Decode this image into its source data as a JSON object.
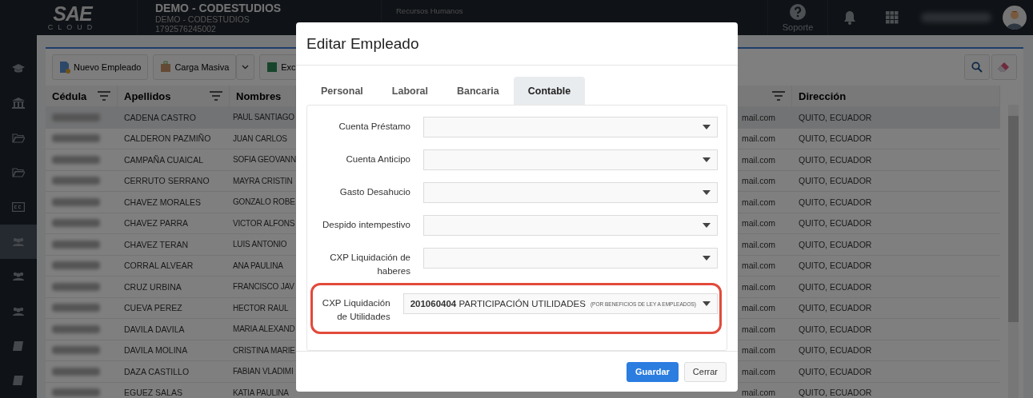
{
  "header": {
    "logo": {
      "word": "SAE",
      "sub": "CLOUD"
    },
    "company": {
      "name": "DEMO - CODESTUDIOS",
      "subtitle": "DEMO - CODESTUDIOS",
      "ruc": "1792576245002"
    },
    "module": {
      "section": "Recursos Humanos"
    },
    "support": "Soporte"
  },
  "sidebar": {
    "items": [
      {
        "selected": false
      },
      {
        "selected": false
      },
      {
        "selected": false
      },
      {
        "selected": false
      },
      {
        "selected": false
      },
      {
        "selected": true
      },
      {
        "selected": false
      },
      {
        "selected": false
      },
      {
        "selected": false
      },
      {
        "selected": false
      }
    ]
  },
  "toolbar": {
    "buttons": [
      "Nuevo Empleado",
      "Carga Masiva",
      "Exc"
    ]
  },
  "table": {
    "columns": [
      "Cédula",
      "Apellidos",
      "Nombres",
      "Dirección"
    ],
    "rows": [
      {
        "apellidos": "CADENA CASTRO",
        "nombres": "PAUL SANTIAGO",
        "email": "mail.com",
        "direccion": "QUITO, ECUADOR"
      },
      {
        "apellidos": "CALDERON PAZMIÑO",
        "nombres": "JUAN CARLOS",
        "email": "mail.com",
        "direccion": "QUITO, ECUADOR"
      },
      {
        "apellidos": "CAMPAÑA CUAICAL",
        "nombres": "SOFIA GEOVANN",
        "email": "mail.com",
        "direccion": "QUITO, ECUADOR"
      },
      {
        "apellidos": "CERRUTO SERRANO",
        "nombres": "MAYRA CRISTIN",
        "email": "mail.com",
        "direccion": "QUITO, ECUADOR"
      },
      {
        "apellidos": "CHAVEZ MORALES",
        "nombres": "GONZALO ROBE",
        "email": "mail.com",
        "direccion": "QUITO, ECUADOR"
      },
      {
        "apellidos": "CHAVEZ PARRA",
        "nombres": "VICTOR ALFONS",
        "email": "mail.com",
        "direccion": "QUITO, ECUADOR"
      },
      {
        "apellidos": "CHAVEZ TERAN",
        "nombres": "LUIS ANTONIO",
        "email": "mail.com",
        "direccion": "QUITO, ECUADOR"
      },
      {
        "apellidos": "CORRAL ALVEAR",
        "nombres": "ANA PAULINA",
        "email": "mail.com",
        "direccion": "QUITO, ECUADOR"
      },
      {
        "apellidos": "CRUZ URBINA",
        "nombres": "FRANCISCO JAV",
        "email": "mail.com",
        "direccion": "QUITO, ECUADOR"
      },
      {
        "apellidos": "CUEVA PEREZ",
        "nombres": "HECTOR RAUL",
        "email": "mail.com",
        "direccion": "QUITO, ECUADOR"
      },
      {
        "apellidos": "DAVILA DAVILA",
        "nombres": "MARIA ALEXAND",
        "email": "mail.com",
        "direccion": "QUITO, ECUADOR"
      },
      {
        "apellidos": "DAVILA MOLINA",
        "nombres": "CRISTINA MARIE",
        "email": "mail.com",
        "direccion": "QUITO, ECUADOR"
      },
      {
        "apellidos": "DAZA CASTILLO",
        "nombres": "FABIAN VLADIMI",
        "email": "mail.com",
        "direccion": "QUITO, ECUADOR"
      },
      {
        "apellidos": "EGUEZ SALAS",
        "nombres": "KATIA PAULINA",
        "email": "mail.com",
        "direccion": "QUITO, ECUADOR"
      }
    ]
  },
  "dialog": {
    "title": "Editar Empleado",
    "tabs": [
      {
        "label": "Personal",
        "selected": false
      },
      {
        "label": "Laboral",
        "selected": false
      },
      {
        "label": "Bancaria",
        "selected": false
      },
      {
        "label": "Contable",
        "selected": true
      }
    ],
    "fields": [
      {
        "label": "Cuenta Préstamo",
        "highlighted": false
      },
      {
        "label": "Cuenta Anticipo",
        "highlighted": false
      },
      {
        "label": "Gasto Desahucio",
        "highlighted": false
      },
      {
        "label": "Despido intempestivo",
        "highlighted": false
      },
      {
        "label": "CXP Liquidación de haberes",
        "highlighted": false
      },
      {
        "label": "CXP Liquidación de Utilidades",
        "highlighted": true,
        "value_code": "201060404",
        "value_text": "PARTICIPACIÓN UTILIDADES",
        "value_note": "(POR BENEFICIOS DE LEY A EMPLEADOS)"
      }
    ],
    "buttons": [
      {
        "label": "Guardar",
        "kind": "primary"
      },
      {
        "label": "Cerrar",
        "kind": "secondary"
      }
    ]
  }
}
